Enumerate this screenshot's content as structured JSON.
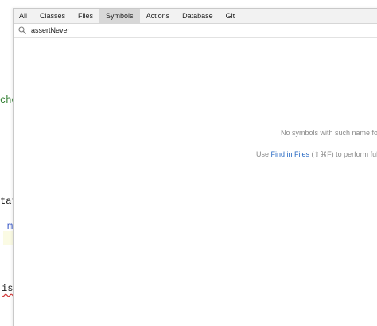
{
  "editor_fragments": {
    "frag_che": "che",
    "frag_tat": "tat",
    "frag_m": "m",
    "frag_is": "is"
  },
  "popup": {
    "tabs": [
      {
        "label": "All"
      },
      {
        "label": "Classes"
      },
      {
        "label": "Files"
      },
      {
        "label": "Symbols"
      },
      {
        "label": "Actions"
      },
      {
        "label": "Database"
      },
      {
        "label": "Git"
      }
    ],
    "selected_tab": "Symbols",
    "search": {
      "value": "assertNever",
      "icon": "search-icon"
    },
    "empty_message": "No symbols with such name fou",
    "hint": {
      "prefix": "Use ",
      "link": "Find in Files",
      "shortcut": " (⇧⌘F)",
      "suffix": " to perform full-"
    }
  },
  "colors": {
    "accent_link": "#2b6cc4",
    "selected_tab_bg": "#d7d7d7",
    "muted_text": "#8a8a8a"
  }
}
